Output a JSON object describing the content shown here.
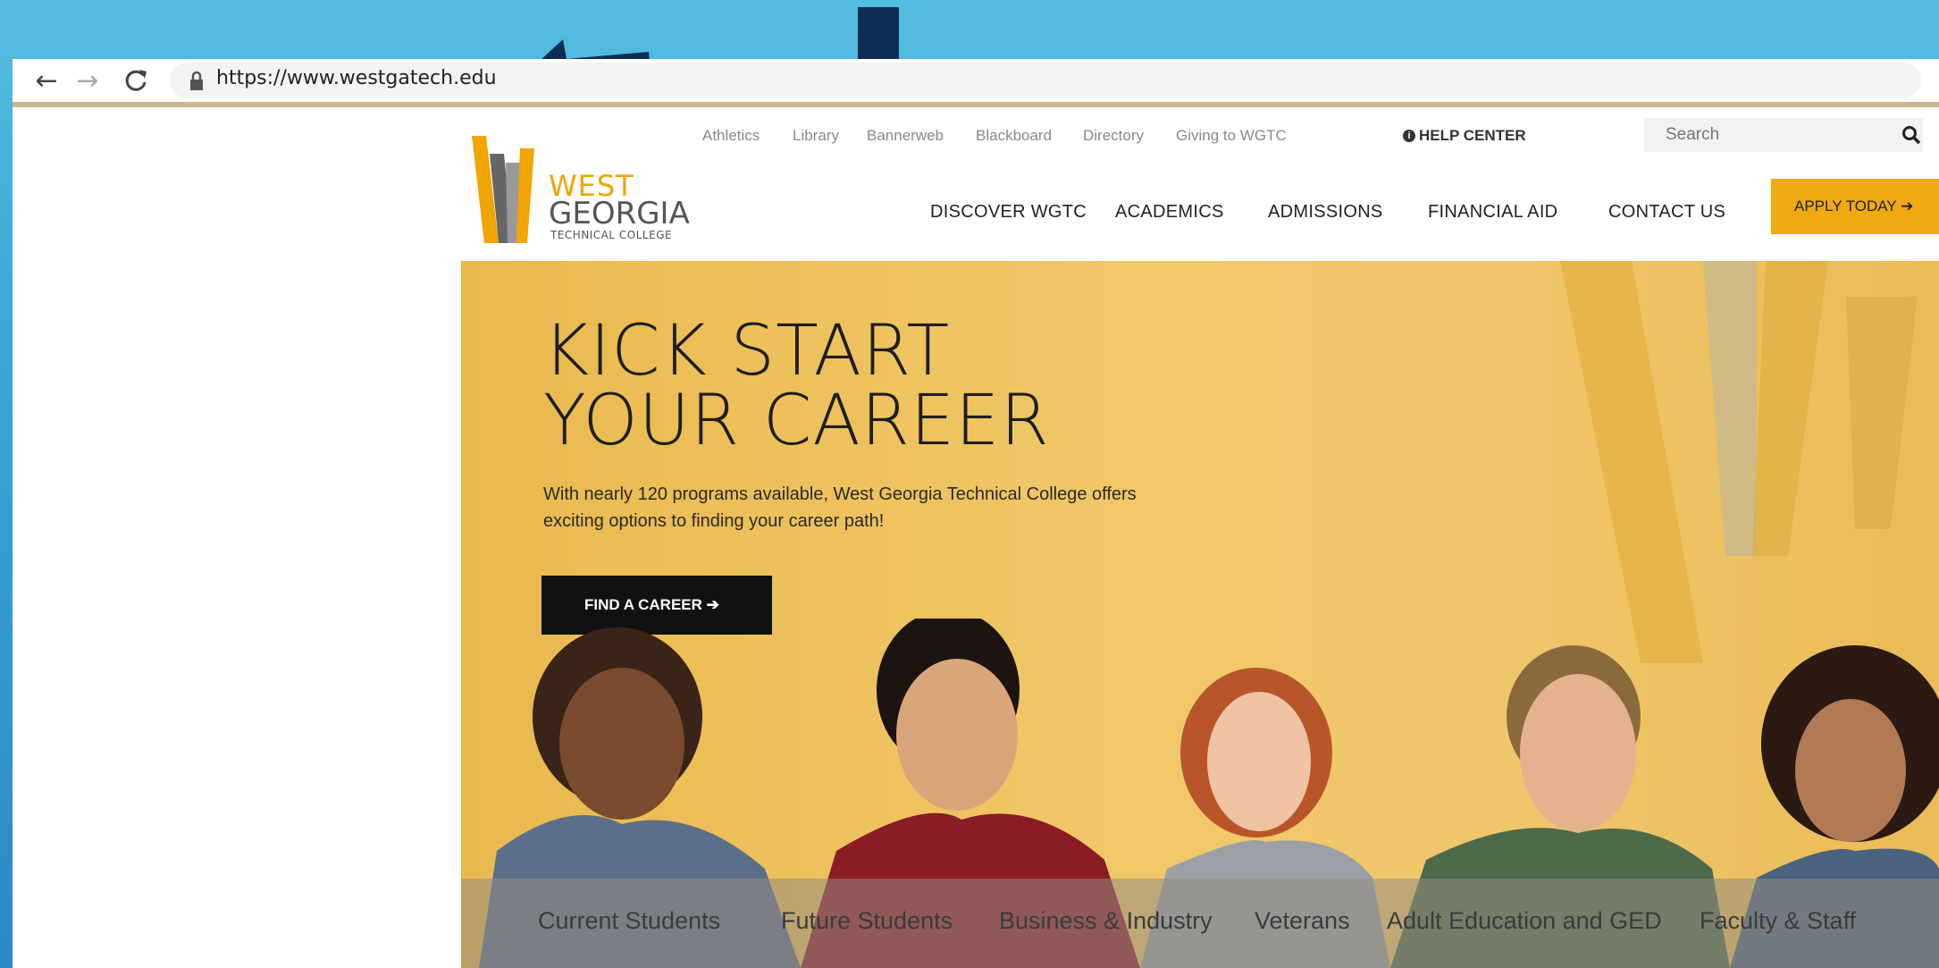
{
  "browser": {
    "url": "https://www.westgatech.edu",
    "back_icon": "←",
    "forward_icon": "→",
    "reload_icon": "C"
  },
  "logo": {
    "line1": "WEST",
    "line2": "GEORGIA",
    "line3": "TECHNICAL COLLEGE"
  },
  "utility_links": [
    "Athletics",
    "Library",
    "Bannerweb",
    "Blackboard",
    "Directory",
    "Giving to WGTC"
  ],
  "help_center": "HELP CENTER",
  "search": {
    "placeholder": "Search",
    "icon": "search-icon"
  },
  "main_nav": [
    "DISCOVER WGTC",
    "ACADEMICS",
    "ADMISSIONS",
    "FINANCIAL AID",
    "CONTACT US"
  ],
  "apply_button": "APPLY TODAY ➔",
  "hero": {
    "title_line1": "KICK START",
    "title_line2": "YOUR CAREER",
    "subtitle_line1": "With nearly 120 programs available, West Georgia Technical College offers",
    "subtitle_line2": "exciting options to finding your career path!",
    "cta": "FIND A CAREER ➔"
  },
  "audience_links": [
    "Current Students",
    "Future Students",
    "Business & Industry",
    "Veterans",
    "Adult Education and GED",
    "Faculty & Staff"
  ],
  "colors": {
    "background": "#3aa6d6",
    "accent_gold": "#f0a910",
    "arrow_navy": "#0d2d55",
    "hero_gold": "#efc66a"
  }
}
